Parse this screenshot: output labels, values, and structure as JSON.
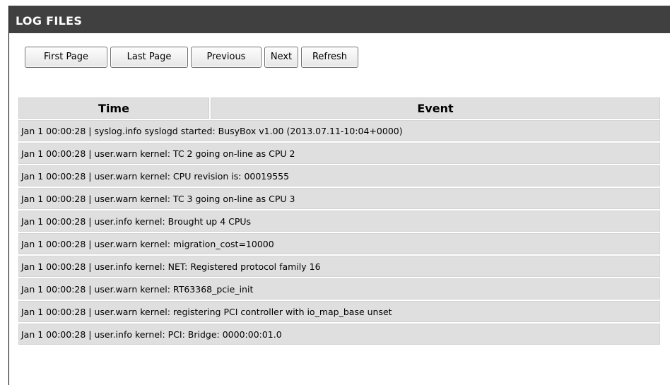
{
  "header": {
    "title": "LOG FILES"
  },
  "toolbar": {
    "first_page": "First Page",
    "last_page": "Last Page",
    "previous": "Previous",
    "next": "Next",
    "refresh": "Refresh"
  },
  "table": {
    "columns": [
      "Time",
      "Event"
    ],
    "rows": [
      "Jan 1 00:00:28 | syslog.info syslogd started: BusyBox v1.00 (2013.07.11-10:04+0000)",
      "Jan 1 00:00:28 | user.warn kernel: TC 2 going on-line as CPU 2",
      "Jan 1 00:00:28 | user.warn kernel: CPU revision is: 00019555",
      "Jan 1 00:00:28 | user.warn kernel: TC 3 going on-line as CPU 3",
      "Jan 1 00:00:28 | user.info kernel: Brought up 4 CPUs",
      "Jan 1 00:00:28 | user.warn kernel: migration_cost=10000",
      "Jan 1 00:00:28 | user.info kernel: NET: Registered protocol family 16",
      "Jan 1 00:00:28 | user.warn kernel: RT63368_pcie_init",
      "Jan 1 00:00:28 | user.warn kernel: registering PCI controller with io_map_base unset",
      "Jan 1 00:00:28 | user.info kernel: PCI: Bridge: 0000:00:01.0"
    ]
  }
}
